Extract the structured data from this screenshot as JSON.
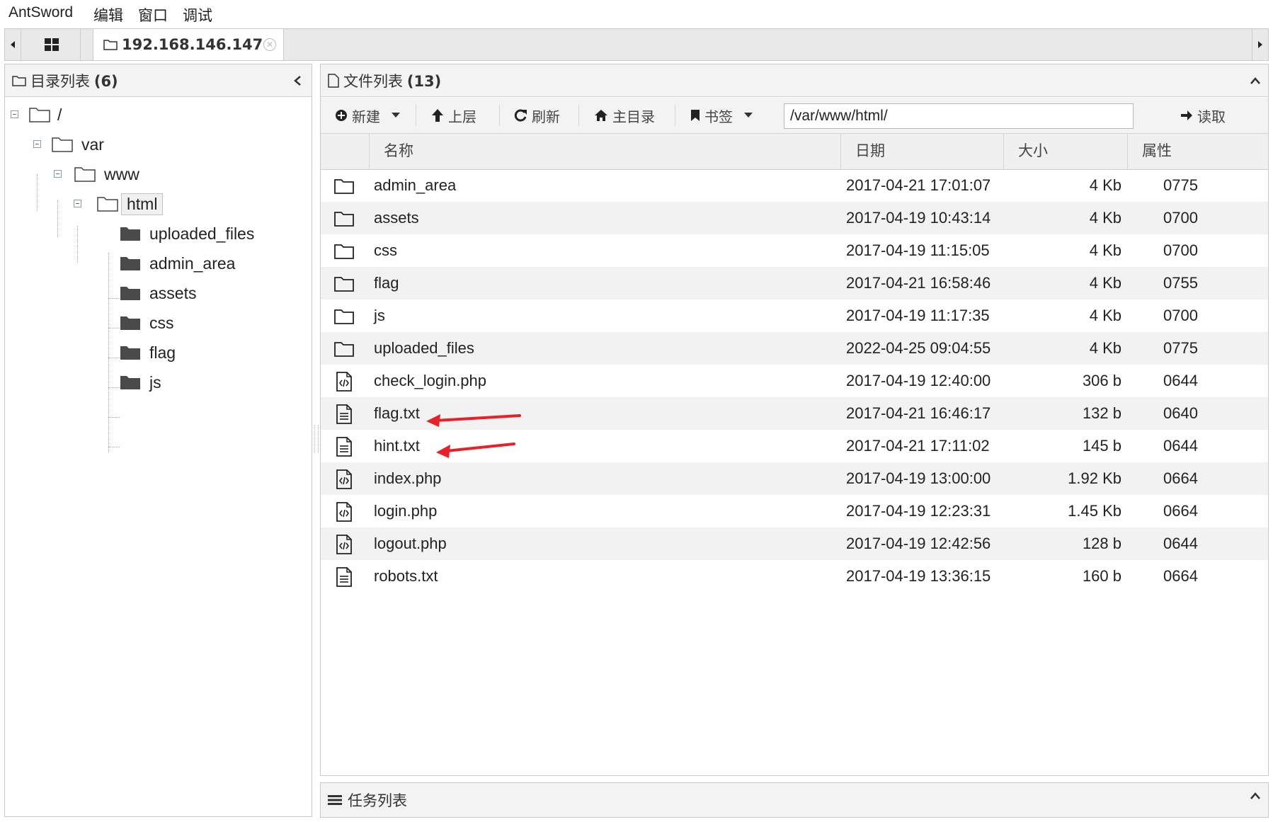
{
  "menu": [
    "AntSword",
    "编辑",
    "窗口",
    "调试"
  ],
  "tab": {
    "title": "192.168.146.147"
  },
  "left_panel": {
    "title": "目录列表",
    "count": "(6)",
    "tree": {
      "root": "/",
      "var": "var",
      "www": "www",
      "html": "html",
      "children": [
        "uploaded_files",
        "admin_area",
        "assets",
        "css",
        "flag",
        "js"
      ]
    }
  },
  "right_panel": {
    "title": "文件列表",
    "count": "(13)",
    "toolbar": {
      "new": "新建",
      "up": "上层",
      "refresh": "刷新",
      "home": "主目录",
      "bookmark": "书签",
      "read": "读取",
      "path": "/var/www/html/"
    },
    "columns": {
      "name": "名称",
      "date": "日期",
      "size": "大小",
      "attr": "属性"
    },
    "files": [
      {
        "type": "folder",
        "name": "admin_area",
        "date": "2017-04-21 17:01:07",
        "size": "4 Kb",
        "attr": "0775"
      },
      {
        "type": "folder",
        "name": "assets",
        "date": "2017-04-19 10:43:14",
        "size": "4 Kb",
        "attr": "0700"
      },
      {
        "type": "folder",
        "name": "css",
        "date": "2017-04-19 11:15:05",
        "size": "4 Kb",
        "attr": "0700"
      },
      {
        "type": "folder",
        "name": "flag",
        "date": "2017-04-21 16:58:46",
        "size": "4 Kb",
        "attr": "0755"
      },
      {
        "type": "folder",
        "name": "js",
        "date": "2017-04-19 11:17:35",
        "size": "4 Kb",
        "attr": "0700"
      },
      {
        "type": "folder",
        "name": "uploaded_files",
        "date": "2022-04-25 09:04:55",
        "size": "4 Kb",
        "attr": "0775"
      },
      {
        "type": "code",
        "name": "check_login.php",
        "date": "2017-04-19 12:40:00",
        "size": "306 b",
        "attr": "0644"
      },
      {
        "type": "text",
        "name": "flag.txt",
        "date": "2017-04-21 16:46:17",
        "size": "132 b",
        "attr": "0640"
      },
      {
        "type": "text",
        "name": "hint.txt",
        "date": "2017-04-21 17:11:02",
        "size": "145 b",
        "attr": "0644"
      },
      {
        "type": "code",
        "name": "index.php",
        "date": "2017-04-19 13:00:00",
        "size": "1.92 Kb",
        "attr": "0664"
      },
      {
        "type": "code",
        "name": "login.php",
        "date": "2017-04-19 12:23:31",
        "size": "1.45 Kb",
        "attr": "0664"
      },
      {
        "type": "code",
        "name": "logout.php",
        "date": "2017-04-19 12:42:56",
        "size": "128 b",
        "attr": "0644"
      },
      {
        "type": "text",
        "name": "robots.txt",
        "date": "2017-04-19 13:36:15",
        "size": "160 b",
        "attr": "0664"
      }
    ]
  },
  "task_panel": {
    "title": "任务列表"
  },
  "colors": {
    "annotation_arrow": "#e8202a",
    "row_alt": "#f2f2f2"
  }
}
